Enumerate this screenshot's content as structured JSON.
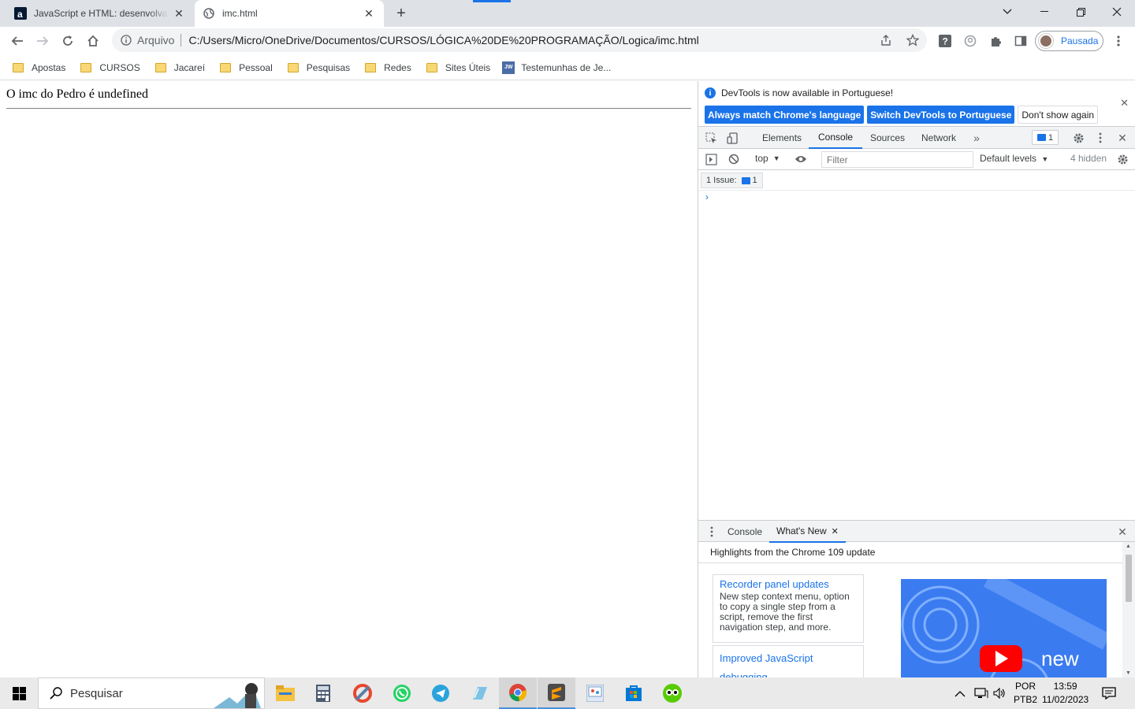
{
  "browser": {
    "tabs": [
      {
        "title": "JavaScript e HTML: desenvolva um",
        "favicon": "alura-icon",
        "active": false
      },
      {
        "title": "imc.html",
        "favicon": "globe-icon",
        "active": true
      }
    ],
    "address": {
      "scheme_label": "Arquivo",
      "url": "C:/Users/Micro/OneDrive/Documentos/CURSOS/LÓGICA%20DE%20PROGRAMAÇÃO/Logica/imc.html"
    },
    "profile_label": "Pausada",
    "bookmarks": [
      {
        "label": "Apostas",
        "icon": "folder-icon"
      },
      {
        "label": "CURSOS",
        "icon": "folder-icon"
      },
      {
        "label": "Jacareí",
        "icon": "folder-icon"
      },
      {
        "label": "Pessoal",
        "icon": "folder-icon"
      },
      {
        "label": "Pesquisas",
        "icon": "folder-icon"
      },
      {
        "label": "Redes",
        "icon": "folder-icon"
      },
      {
        "label": "Sites Úteis",
        "icon": "folder-icon"
      },
      {
        "label": "Testemunhas de Je...",
        "icon": "jw-icon"
      }
    ],
    "jw_badge": "JW"
  },
  "page": {
    "message": "O imc do Pedro é undefined"
  },
  "devtools": {
    "infobar": {
      "message": "DevTools is now available in Portuguese!",
      "btn_match": "Always match Chrome's language",
      "btn_switch": "Switch DevTools to Portuguese",
      "btn_dismiss": "Don't show again"
    },
    "tabs": [
      "Elements",
      "Console",
      "Sources",
      "Network"
    ],
    "selected_tab": "Console",
    "issue_count": "1",
    "console": {
      "context": "top",
      "filter_placeholder": "Filter",
      "levels": "Default levels",
      "hidden": "4 hidden",
      "issues_label": "1 Issue:",
      "issues_count": "1",
      "prompt": "›"
    },
    "drawer": {
      "tabs": [
        "Console",
        "What's New"
      ],
      "selected_tab": "What's New",
      "heading": "Highlights from the Chrome 109 update",
      "cards": [
        {
          "title": "Recorder panel updates",
          "desc": "New step context menu, option to copy a single step from a script, remove the first navigation step, and more."
        },
        {
          "title": "Improved JavaScript debugging",
          "desc": ""
        }
      ],
      "video_label": "new"
    }
  },
  "taskbar": {
    "search_placeholder": "Pesquisar",
    "apps": [
      "file-explorer-icon",
      "calculator-icon",
      "ccleaner-icon",
      "whatsapp-icon",
      "telegram-icon",
      "notepad-icon",
      "chrome-icon",
      "sublime-text-icon",
      "paint-icon",
      "store-icon",
      "duolingo-icon"
    ],
    "active_app": "chrome-icon",
    "lang_top": "POR",
    "lang_bottom": "PTB2",
    "time": "13:59",
    "date": "11/02/2023"
  },
  "colors": {
    "accent": "#1a73e8",
    "tabstrip": "#dee1e6",
    "folder": "#f8d775"
  }
}
